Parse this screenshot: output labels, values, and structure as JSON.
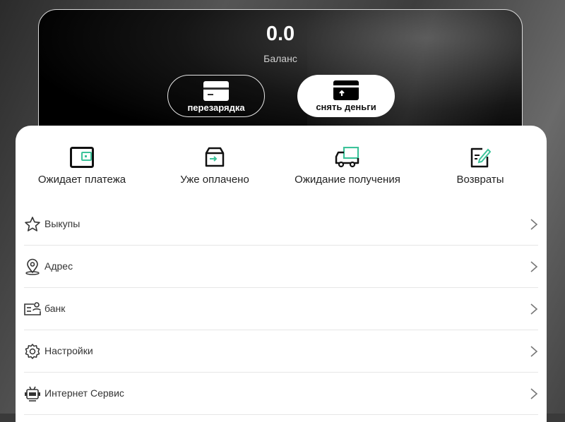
{
  "balance": {
    "value": "0.0",
    "label": "Баланс"
  },
  "actions": {
    "recharge_label": "перезарядка",
    "withdraw_label": "снять деньги"
  },
  "orders": [
    {
      "label": "Ожидает платежа",
      "icon": "wallet-icon"
    },
    {
      "label": "Уже оплачено",
      "icon": "box-icon"
    },
    {
      "label": "Ожидание получения",
      "icon": "truck-icon"
    },
    {
      "label": "Возвраты",
      "icon": "edit-document-icon"
    }
  ],
  "menu": [
    {
      "label": "Выкупы",
      "icon": "star-icon"
    },
    {
      "label": "Адрес",
      "icon": "location-pin-icon"
    },
    {
      "label": "банк",
      "icon": "bank-card-icon"
    },
    {
      "label": "Настройки",
      "icon": "gear-icon"
    },
    {
      "label": "Интернет Сервис",
      "icon": "robot-icon"
    }
  ],
  "colors": {
    "accent": "#3cc39a",
    "dark": "#000000",
    "text": "#333333"
  }
}
